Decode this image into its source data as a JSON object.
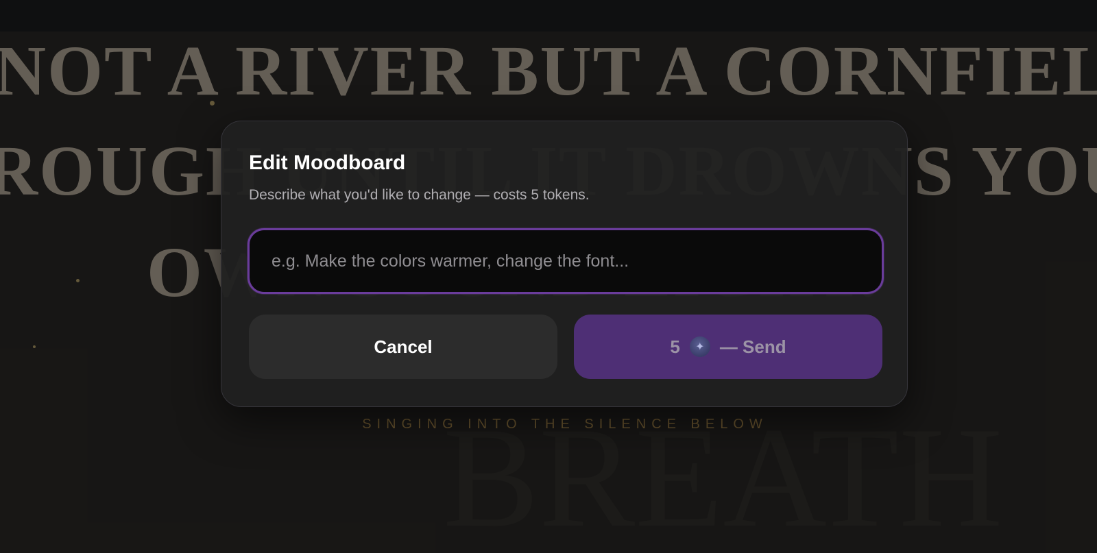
{
  "background": {
    "headline_lines": [
      "NOT A RIVER BUT A CORNFIELD",
      "ROUGH UNTIL IT DROWNS YOU",
      "OWN SOUND LIGHT."
    ],
    "tagline": "SINGING INTO THE SILENCE BELOW",
    "watermark_word": "BREATH"
  },
  "modal": {
    "title": "Edit Moodboard",
    "description": "Describe what you'd like to change — costs 5 tokens.",
    "input": {
      "value": "",
      "placeholder": "e.g. Make the colors warmer, change the font..."
    },
    "cancel_label": "Cancel",
    "send": {
      "cost": "5",
      "icon": "sparkle-token-icon",
      "label": "— Send"
    }
  },
  "colors": {
    "accent": "#6a3c9b",
    "send_button": "#4e2f75",
    "tagline": "#8b6f3c"
  }
}
